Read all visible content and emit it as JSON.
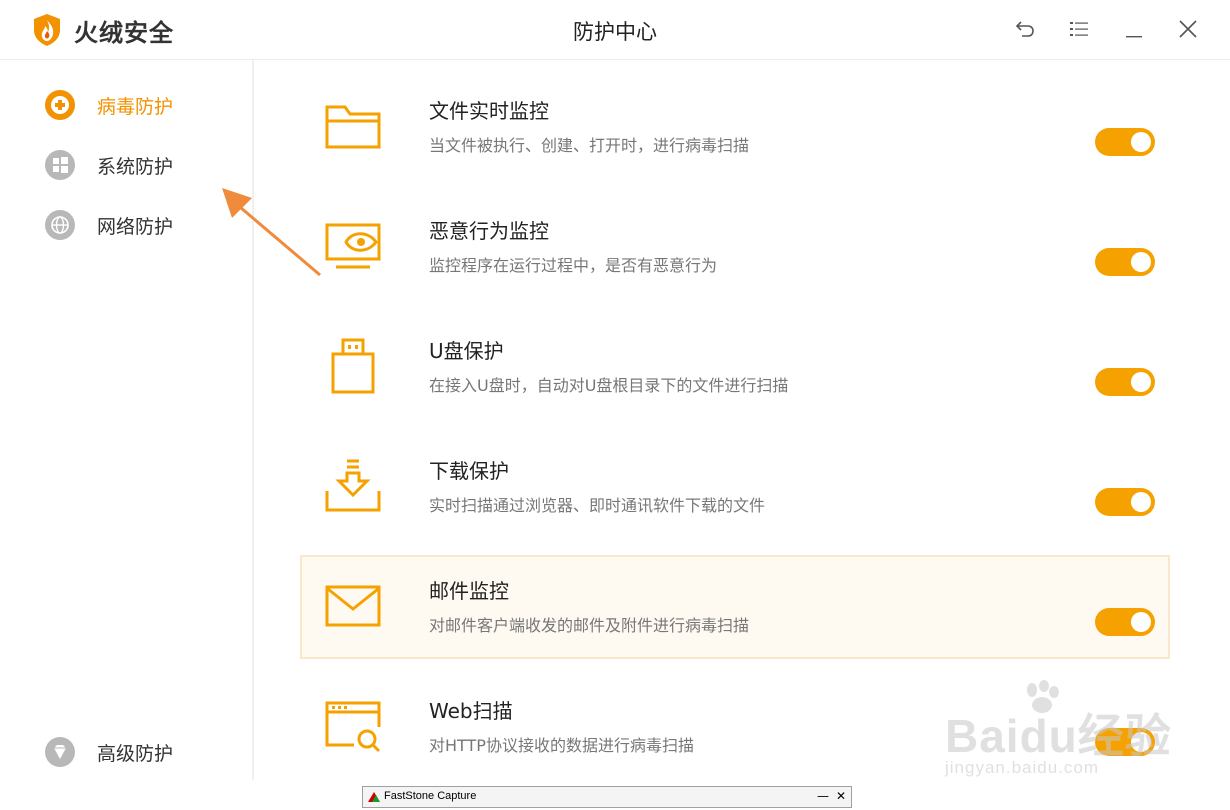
{
  "app": {
    "name": "火绒安全",
    "window_title": "防护中心"
  },
  "sidebar": {
    "items": [
      {
        "label": "病毒防护",
        "icon": "plus-circle-icon",
        "active": true
      },
      {
        "label": "系统防护",
        "icon": "windows-icon",
        "active": false
      },
      {
        "label": "网络防护",
        "icon": "globe-icon",
        "active": false
      },
      {
        "label": "高级防护",
        "icon": "diamond-icon",
        "active": false
      }
    ]
  },
  "features": [
    {
      "title": "文件实时监控",
      "desc": "当文件被执行、创建、打开时，进行病毒扫描",
      "icon": "folder-icon",
      "enabled": true
    },
    {
      "title": "恶意行为监控",
      "desc": "监控程序在运行过程中，是否有恶意行为",
      "icon": "monitor-eye-icon",
      "enabled": true
    },
    {
      "title": "U盘保护",
      "desc": "在接入U盘时，自动对U盘根目录下的文件进行扫描",
      "icon": "usb-drive-icon",
      "enabled": true
    },
    {
      "title": "下载保护",
      "desc": "实时扫描通过浏览器、即时通讯软件下载的文件",
      "icon": "download-icon",
      "enabled": true
    },
    {
      "title": "邮件监控",
      "desc": "对邮件客户端收发的邮件及附件进行病毒扫描",
      "icon": "mail-icon",
      "enabled": true,
      "highlighted": true
    },
    {
      "title": "Web扫描",
      "desc": "对HTTP协议接收的数据进行病毒扫描",
      "icon": "browser-search-icon",
      "enabled": true
    }
  ],
  "watermark": {
    "main": "Baidu经验",
    "sub": "jingyan.baidu.com"
  },
  "taskbar": {
    "title": "FastStone Capture",
    "minimize": "—",
    "close": "✕"
  },
  "colors": {
    "accent": "#f39200",
    "toggle_on": "#f5a200",
    "icon_gray": "#b8b8b8",
    "highlight_bg": "#fffaf1"
  }
}
